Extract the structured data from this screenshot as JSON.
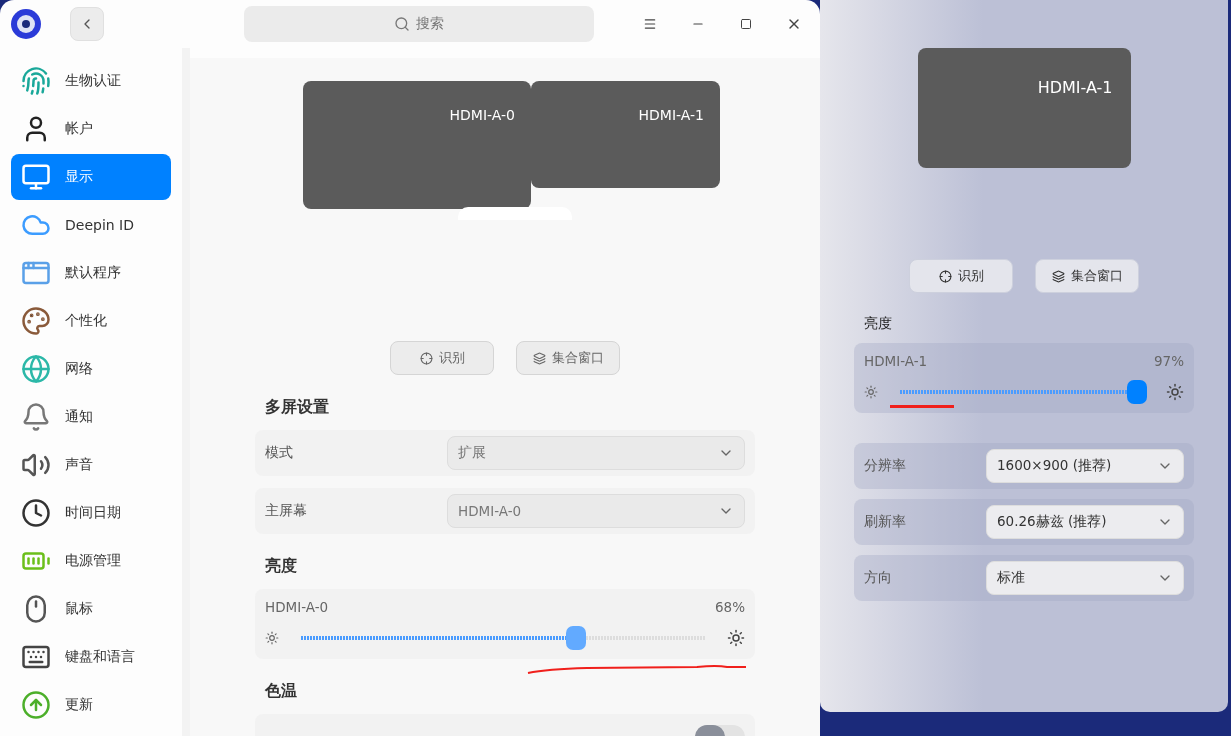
{
  "window": {
    "search": {
      "placeholder": "搜索"
    }
  },
  "sidebar": {
    "items": [
      {
        "label": "生物认证",
        "selected": false
      },
      {
        "label": "帐户",
        "selected": false
      },
      {
        "label": "显示",
        "selected": true
      },
      {
        "label": "Deepin ID",
        "selected": false
      },
      {
        "label": "默认程序",
        "selected": false
      },
      {
        "label": "个性化",
        "selected": false
      },
      {
        "label": "网络",
        "selected": false
      },
      {
        "label": "通知",
        "selected": false
      },
      {
        "label": "声音",
        "selected": false
      },
      {
        "label": "时间日期",
        "selected": false
      },
      {
        "label": "电源管理",
        "selected": false
      },
      {
        "label": "鼠标",
        "selected": false
      },
      {
        "label": "键盘和语言",
        "selected": false
      },
      {
        "label": "更新",
        "selected": false
      }
    ]
  },
  "display": {
    "monitors": [
      {
        "name": "HDMI-A-0"
      },
      {
        "name": "HDMI-A-1"
      }
    ],
    "buttons": [
      "识别",
      "集合窗口"
    ],
    "multi_screen": {
      "title": "多屏设置",
      "rows": [
        {
          "label": "模式",
          "value": "扩展",
          "disabled": true
        },
        {
          "label": "主屏幕",
          "value": "HDMI-A-0",
          "disabled": true
        }
      ]
    },
    "brightness": {
      "title": "亮度",
      "sliders": [
        {
          "name": "HDMI-A-0",
          "reading": "68%",
          "level": 0.68
        }
      ]
    },
    "color_temperature": {
      "title": "色温",
      "toggle": {
        "on": false
      }
    }
  },
  "side_panel": {
    "monitor": {
      "name": "HDMI-A-1"
    },
    "buttons": [
      "识别",
      "集合窗口"
    ],
    "brightness": {
      "title": "亮度",
      "sliders": [
        {
          "name": "HDMI-A-1",
          "reading": "97%",
          "level": 0.97
        }
      ]
    },
    "rows": [
      {
        "label": "分辨率",
        "value": "1600×900 (推荐)",
        "disabled": false
      },
      {
        "label": "刷新率",
        "value": "60.26赫兹 (推荐)",
        "disabled": false
      },
      {
        "label": "方向",
        "value": "标准",
        "disabled": false
      }
    ]
  }
}
